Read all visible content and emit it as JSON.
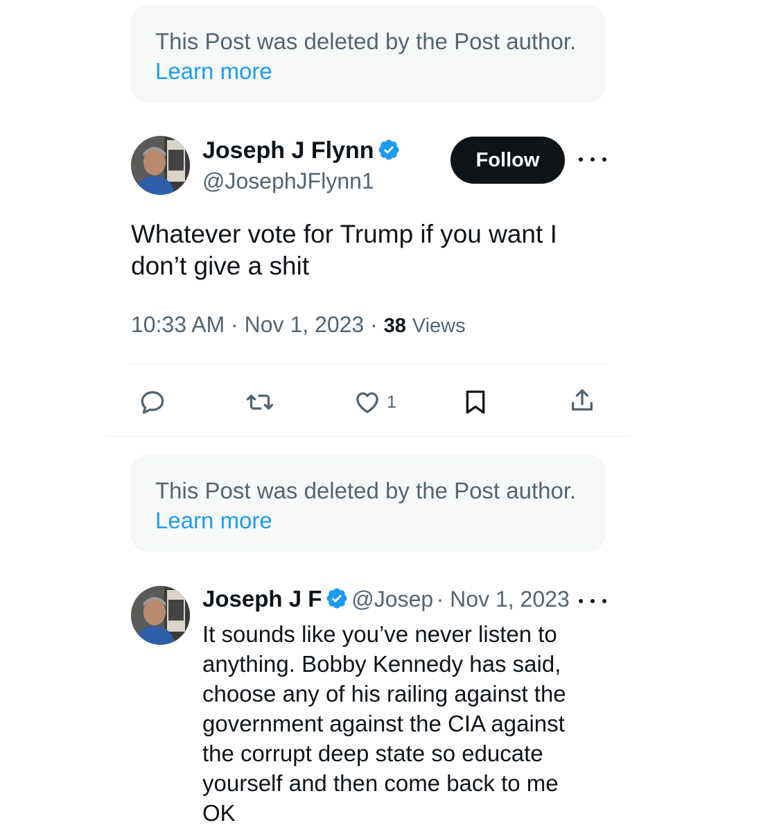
{
  "deleted_notice_1": {
    "text": "This Post was deleted by the Post author.",
    "link": "Learn more"
  },
  "main_post": {
    "author_name": "Joseph J Flynn",
    "handle": "@JosephJFlynn1",
    "follow_label": "Follow",
    "text": "Whatever vote for Trump if you want I don’t give a shit",
    "time": "10:33 AM",
    "date": "Nov 1, 2023",
    "views_count": "38",
    "views_label": "Views",
    "like_count": "1",
    "accent_color": "#1d9bf0"
  },
  "deleted_notice_2": {
    "text": "This Post was deleted by the Post author.",
    "link": "Learn more"
  },
  "reply_post": {
    "author_name_truncated": "Joseph J F",
    "handle_truncated": "@Josep",
    "date": "Nov 1, 2023",
    "text": "It sounds like you’ve never listen to anything. Bobby Kennedy has said, choose any of his railing against the government against the CIA against the corrupt deep state so educate yourself and then come back to me OK"
  },
  "icons": [
    "verified-badge-icon",
    "more-icon",
    "reply-icon",
    "repost-icon",
    "like-icon",
    "bookmark-icon",
    "share-icon"
  ]
}
